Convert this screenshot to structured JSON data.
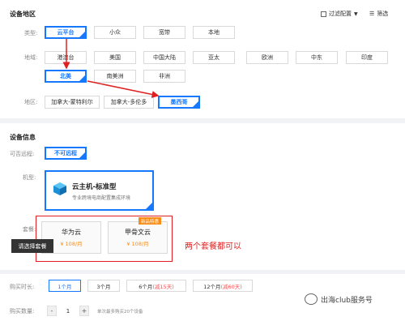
{
  "device_region": {
    "title": "设备地区",
    "filter_config": "过滤配置",
    "filter": "筛选",
    "type_label": "类型:",
    "type_options": [
      "云平台",
      "小众",
      "宽带",
      "本地"
    ],
    "region_label": "地域:",
    "region_options_row1": [
      "港澳台",
      "美国",
      "中国大陆",
      "亚太",
      "欧洲",
      "中东",
      "印度"
    ],
    "region_options_row2": [
      "北美",
      "南美洲",
      "非洲"
    ],
    "area_label": "地区:",
    "area_options": [
      "加拿大-蒙特利尔",
      "加拿大-多伦多",
      "墨西哥"
    ]
  },
  "device_info": {
    "title": "设备信息",
    "remote_label": "可否远程:",
    "remote_option": "不可远程",
    "model_label": "机型:",
    "machine_title": "云主机-标准型",
    "machine_desc": "专业跨境电商配置集成环境",
    "package_label": "套餐:",
    "packages": [
      {
        "name": "华为云",
        "price": "¥ 108/月"
      },
      {
        "name": "甲骨文云",
        "price": "¥ 108/月"
      }
    ],
    "new_badge": "新品特惠",
    "tooltip": "请选择套餐",
    "annotation": "两个套餐都可以"
  },
  "purchase": {
    "duration_label": "购买时长:",
    "durations": [
      "1个月",
      "3个月",
      "6个月",
      "12个月"
    ],
    "disc6": "(减15天)",
    "disc12": "(减60天)",
    "qty_label": "购买数量:",
    "qty_minus": "-",
    "qty_value": "1",
    "qty_plus": "+",
    "qty_hint": "单次最多购买20个设备"
  },
  "watermark": "出海club服务号",
  "colors": {
    "accent": "#1677ff",
    "annotation": "#e02020",
    "price": "#fa8c16"
  }
}
